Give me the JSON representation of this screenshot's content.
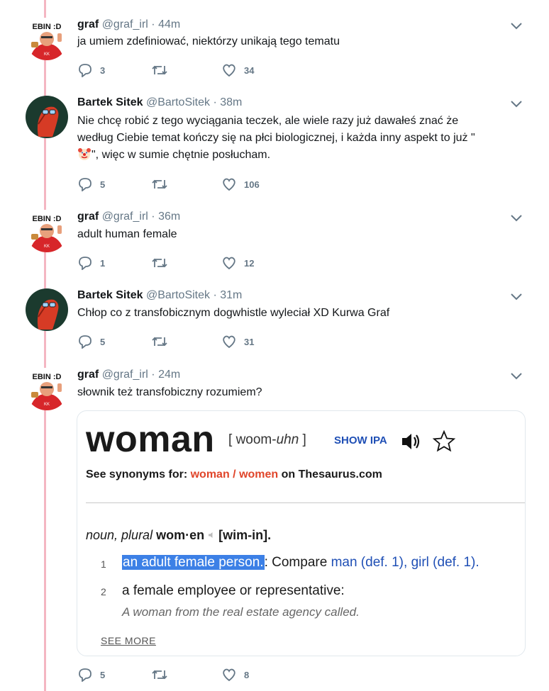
{
  "tweets": [
    {
      "name": "graf",
      "handle": "@graf_irl",
      "time": "44m",
      "text": "ja umiem zdefiniować, niektórzy unikają tego tematu",
      "replies": "3",
      "retweets": "",
      "likes": "34",
      "avatar": "graf-avatar"
    },
    {
      "name": "Bartek Sitek",
      "handle": "@BartoSitek",
      "time": "38m",
      "text_line1": "Nie chcę robić z tego wyciągania teczek, ale wiele razy już dawałeś znać że",
      "text_line2": "według Ciebie temat kończy się na płci biologicznej, i każda inny aspekt to już \"",
      "text_line3_emoji": "clown-face",
      "text_line3": "\", więc w sumie chętnie posłucham.",
      "replies": "5",
      "retweets": "",
      "likes": "106",
      "avatar": "bartek-avatar"
    },
    {
      "name": "graf",
      "handle": "@graf_irl",
      "time": "36m",
      "text": "adult human female",
      "replies": "1",
      "retweets": "",
      "likes": "12",
      "avatar": "graf-avatar"
    },
    {
      "name": "Bartek Sitek",
      "handle": "@BartoSitek",
      "time": "31m",
      "text": "Chłop co z transfobicznym dogwhistle wyleciał XD Kurwa Graf",
      "replies": "5",
      "retweets": "",
      "likes": "31",
      "avatar": "bartek-avatar"
    },
    {
      "name": "graf",
      "handle": "@graf_irl",
      "time": "24m",
      "text": "słownik też transfobiczny rozumiem?",
      "replies": "5",
      "retweets": "",
      "likes": "8",
      "avatar": "graf-avatar"
    }
  ],
  "avatar_badge_text": "EBIN :D",
  "avatar_shirt_text": "KK",
  "separator": "·",
  "dictionary": {
    "word": "woman",
    "pron_open": "[ ",
    "pron_syll": "woom-",
    "pron_italic": "uhn",
    "pron_close": " ]",
    "show_ipa": "SHOW IPA",
    "synonyms_prefix": "See synonyms for: ",
    "synonyms_links": "woman / women",
    "synonyms_suffix": " on Thesaurus.com",
    "pos_italic": "noun, plural",
    "pos_word": "wom·en",
    "pos_pron": "[wim-in].",
    "defs": [
      {
        "num": "1",
        "highlight": "an adult female person.",
        "rest": ": Compare ",
        "link1": "man (def. 1)",
        "sep": ", ",
        "link2": "girl (def. 1)",
        "end": "."
      },
      {
        "num": "2",
        "text": "a female employee or representative:",
        "example": "A woman from the real estate agency called."
      }
    ],
    "see_more": "SEE MORE"
  },
  "colors": {
    "thread_line": "#f4b6c2",
    "action_gray": "#657786",
    "link_blue": "#1f4fb5",
    "synonym_red": "#e0452a",
    "highlight": "#3c80e6"
  }
}
